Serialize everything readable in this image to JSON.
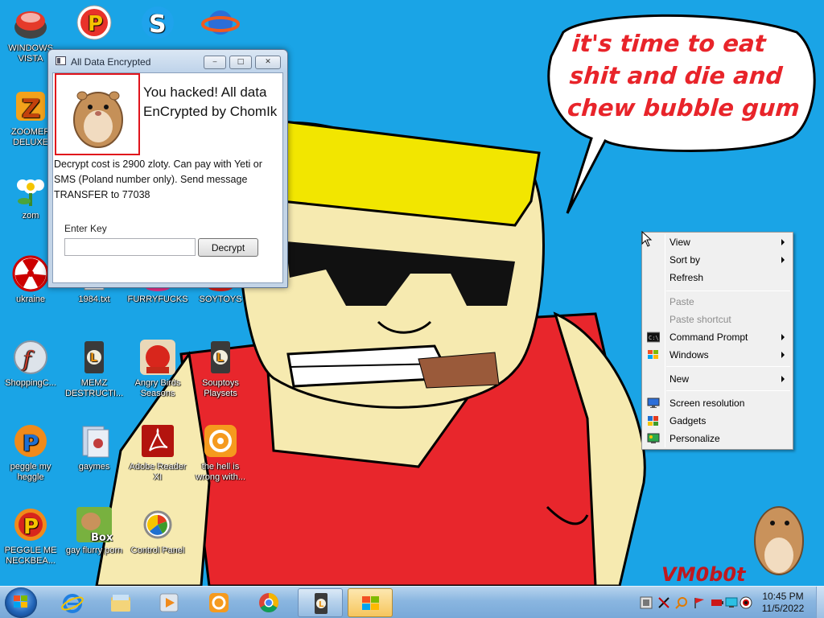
{
  "wallpaper": {
    "speech_bubble": "it's time to eat shit and die and chew bubble gum",
    "signature": "VM0b0t",
    "colors": {
      "sky": "#1aa4e6",
      "hair": "#f2e600",
      "shirt": "#e8262c",
      "bubble_text": "#e8242a"
    }
  },
  "desktop_icons": [
    {
      "label": "WINDOWS VISTA",
      "icon": "vista-orb-icon"
    },
    {
      "label": "",
      "icon": "peggle-p-icon"
    },
    {
      "label": "",
      "icon": "skype-icon"
    },
    {
      "label": "",
      "icon": "globe-ring-icon"
    },
    {
      "label": "ZOOMER DELUXE",
      "icon": "zoomer-icon"
    },
    {
      "label": "zom",
      "icon": "flower-zombie-icon"
    },
    {
      "label": "ukraine",
      "icon": "radiation-icon"
    },
    {
      "label": "1984.txt",
      "icon": "text-file-icon"
    },
    {
      "label": "FURRYFUCKS",
      "icon": "pink-app-icon"
    },
    {
      "label": "SOYTOYS",
      "icon": "red-app-icon"
    },
    {
      "label": "ShoppingC...",
      "icon": "flash-icon"
    },
    {
      "label": "MEMZ DESTRUCTI...",
      "icon": "memz-icon"
    },
    {
      "label": "Angry Birds Seasons",
      "icon": "angry-birds-icon"
    },
    {
      "label": "Souptoys Playsets",
      "icon": "souptoys-icon"
    },
    {
      "label": "peggle my heggle",
      "icon": "peggle-icon"
    },
    {
      "label": "gaymes",
      "icon": "games-folder-icon"
    },
    {
      "label": "Adobe Reader XI",
      "icon": "adobe-reader-icon"
    },
    {
      "label": "the hell is wrong with...",
      "icon": "uc-browser-icon"
    },
    {
      "label": "PEGGLE ME NECKBEA...",
      "icon": "peggle-icon"
    },
    {
      "label": "gay flurry porn",
      "icon": "hamster-box-icon"
    },
    {
      "label": "Control Panel",
      "icon": "control-panel-icon"
    }
  ],
  "ransom_window": {
    "title": "All Data Encrypted",
    "headline": "You hacked! All data EnCrypted by ChomIk",
    "message": "Decrypt cost is 2900 zloty. Can pay with Yeti or SMS (Poland number only). Send message TRANSFER to 77038",
    "key_label": "Enter Key",
    "key_value": "",
    "decrypt_label": "Decrypt",
    "minimize": "‒",
    "maximize": "□",
    "close": "✕"
  },
  "context_menu": {
    "items": [
      {
        "label": "View",
        "submenu": true,
        "enabled": true
      },
      {
        "label": "Sort by",
        "submenu": true,
        "enabled": true
      },
      {
        "label": "Refresh",
        "submenu": false,
        "enabled": true
      },
      {
        "label": "Paste",
        "submenu": false,
        "enabled": false
      },
      {
        "label": "Paste shortcut",
        "submenu": false,
        "enabled": false
      },
      {
        "label": "Command Prompt",
        "submenu": true,
        "enabled": true,
        "icon": "cmd-icon"
      },
      {
        "label": "Windows",
        "submenu": true,
        "enabled": true,
        "icon": "windows-flag-icon"
      },
      {
        "label": "New",
        "submenu": true,
        "enabled": true
      },
      {
        "label": "Screen resolution",
        "submenu": false,
        "enabled": true,
        "icon": "monitor-icon"
      },
      {
        "label": "Gadgets",
        "submenu": false,
        "enabled": true,
        "icon": "gadgets-icon"
      },
      {
        "label": "Personalize",
        "submenu": false,
        "enabled": true,
        "icon": "personalize-icon"
      }
    ]
  },
  "taskbar": {
    "pinned": [
      "internet-explorer-icon",
      "explorer-folder-icon",
      "media-player-icon",
      "uc-browser-icon",
      "chrome-icon",
      "memz-icon",
      "windows-flag-icon"
    ],
    "clock": {
      "time": "10:45 PM",
      "date": "11/5/2022"
    }
  }
}
